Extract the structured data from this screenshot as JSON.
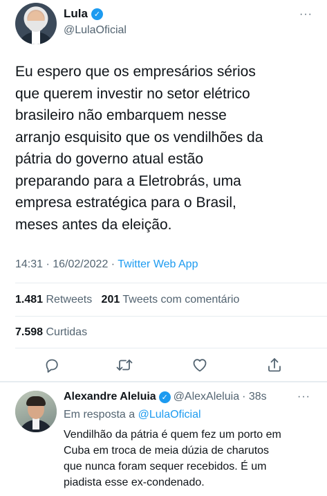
{
  "tweet": {
    "author_name": "Lula",
    "author_handle": "@LulaOficial",
    "text_lines": [
      "Eu espero que os empresários sérios",
      "que querem investir no setor elétrico",
      "brasileiro não embarquem nesse",
      "arranjo esquisito que os vendilhões da",
      "pátria do governo atual estão",
      "preparando para a Eletrobrás, uma",
      "empresa estratégica para o Brasil,",
      "meses antes da eleição."
    ],
    "timestamp": "14:31 · 16/02/2022 · ",
    "source": "Twitter Web App",
    "retweets_count": "1.481",
    "retweets_label": "Retweets",
    "quotes_count": "201",
    "quotes_label": "Tweets com comentário",
    "likes_count": "7.598",
    "likes_label": "Curtidas",
    "more_label": "···",
    "verified_mark": "✓"
  },
  "reply": {
    "author_name": "Alexandre Aleluia",
    "author_handle": "@AlexAleluia",
    "time": "· 38s",
    "in_reply_prefix": "Em resposta a ",
    "in_reply_mention": "@LulaOficial",
    "text_lines": [
      "Vendilhão da pátria é quem fez um porto em",
      "Cuba em troca de meia dúzia de charutos",
      "que nunca foram sequer recebidos. É um",
      "piadista esse ex-condenado."
    ],
    "more_label": "···",
    "verified_mark": "✓"
  },
  "colors": {
    "accent": "#1d9bf0",
    "secondary_text": "#536471",
    "primary_text": "#0f1419",
    "divider": "#e6ecf0"
  },
  "icons": [
    "reply-icon",
    "retweet-icon",
    "like-icon",
    "share-icon",
    "verified-badge-icon",
    "more-icon"
  ]
}
